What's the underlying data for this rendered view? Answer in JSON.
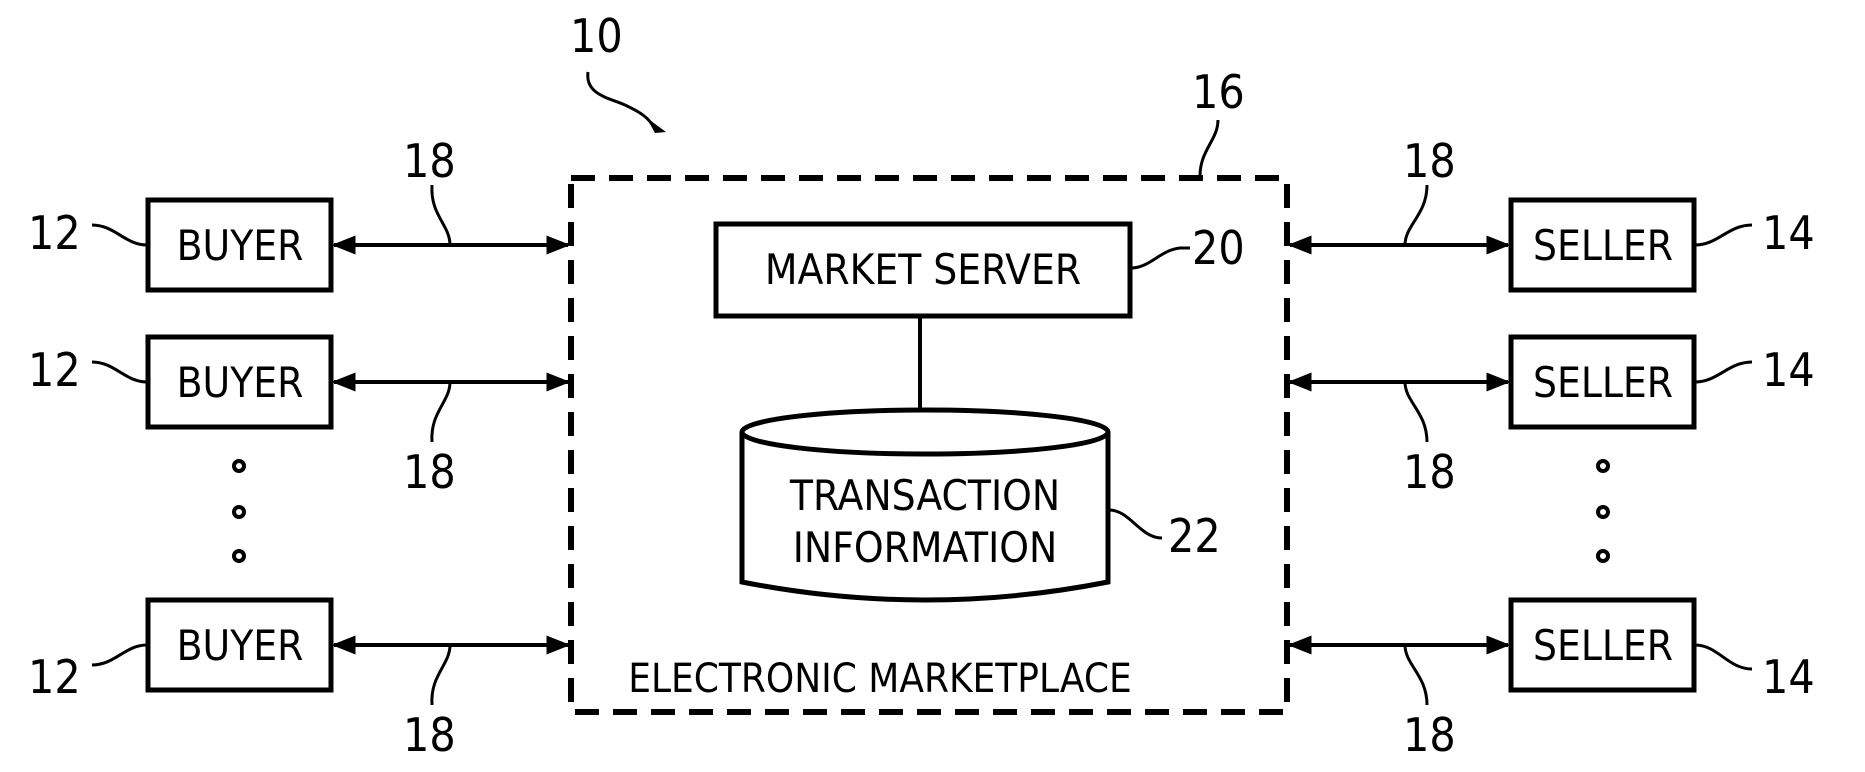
{
  "figure": {
    "system_ref": "10",
    "marketplace": {
      "ref": "16",
      "caption": "ELECTRONIC MARKETPLACE",
      "market_server": {
        "label": "MARKET SERVER",
        "ref": "20"
      },
      "database": {
        "line1": "TRANSACTION",
        "line2": "INFORMATION",
        "ref": "22"
      }
    },
    "buyers": [
      {
        "label": "BUYER",
        "ref": "12",
        "link_ref": "18"
      },
      {
        "label": "BUYER",
        "ref": "12",
        "link_ref": "18"
      },
      {
        "label": "BUYER",
        "ref": "12",
        "link_ref": "18"
      }
    ],
    "sellers": [
      {
        "label": "SELLER",
        "ref": "14",
        "link_ref": "18"
      },
      {
        "label": "SELLER",
        "ref": "14",
        "link_ref": "18"
      },
      {
        "label": "SELLER",
        "ref": "14",
        "link_ref": "18"
      }
    ],
    "ellipsis": "continuation-dots"
  }
}
